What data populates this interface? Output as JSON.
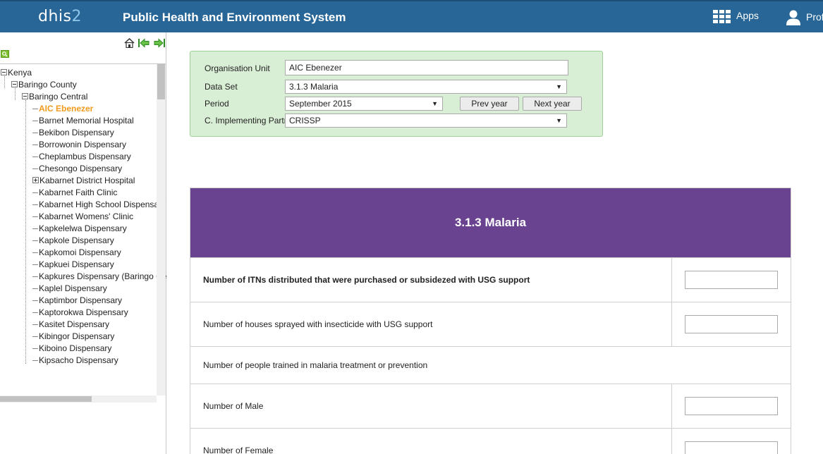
{
  "header": {
    "logo_main": "dhis",
    "logo_num": "2",
    "title": "Public Health and Environment System",
    "apps_label": "Apps",
    "profile_label": "Profile"
  },
  "sidebar": {
    "tree": [
      {
        "label": "Kenya",
        "level": 0,
        "toggle": "minus"
      },
      {
        "label": "Baringo County",
        "level": 1,
        "toggle": "minus"
      },
      {
        "label": "Baringo Central",
        "level": 2,
        "toggle": "minus"
      },
      {
        "label": "AIC Ebenezer",
        "level": 3,
        "toggle": "leaf",
        "selected": true
      },
      {
        "label": "Barnet Memorial Hospital",
        "level": 3,
        "toggle": "leaf"
      },
      {
        "label": "Bekibon Dispensary",
        "level": 3,
        "toggle": "leaf"
      },
      {
        "label": "Borrowonin Dispensary",
        "level": 3,
        "toggle": "leaf"
      },
      {
        "label": "Cheplambus Dispensary",
        "level": 3,
        "toggle": "leaf"
      },
      {
        "label": "Chesongo Dispensary",
        "level": 3,
        "toggle": "leaf"
      },
      {
        "label": "Kabarnet District Hospital",
        "level": 3,
        "toggle": "plus"
      },
      {
        "label": "Kabarnet Faith Clinic",
        "level": 3,
        "toggle": "leaf"
      },
      {
        "label": "Kabarnet High School Dispensary",
        "level": 3,
        "toggle": "leaf"
      },
      {
        "label": "Kabarnet Womens' Clinic",
        "level": 3,
        "toggle": "leaf"
      },
      {
        "label": "Kapkelelwa Dispensary",
        "level": 3,
        "toggle": "leaf"
      },
      {
        "label": "Kapkole Dispensary",
        "level": 3,
        "toggle": "leaf"
      },
      {
        "label": "Kapkomoi Dispensary",
        "level": 3,
        "toggle": "leaf"
      },
      {
        "label": "Kapkuei Dispensary",
        "level": 3,
        "toggle": "leaf"
      },
      {
        "label": "Kapkures Dispensary (Baringo Central)",
        "level": 3,
        "toggle": "leaf"
      },
      {
        "label": "Kaplel Dispensary",
        "level": 3,
        "toggle": "leaf"
      },
      {
        "label": "Kaptimbor Dispensary",
        "level": 3,
        "toggle": "leaf"
      },
      {
        "label": "Kaptorokwa Dispensary",
        "level": 3,
        "toggle": "leaf"
      },
      {
        "label": "Kasitet Dispensary",
        "level": 3,
        "toggle": "leaf"
      },
      {
        "label": "Kibingor Dispensary",
        "level": 3,
        "toggle": "leaf"
      },
      {
        "label": "Kiboino Dispensary",
        "level": 3,
        "toggle": "leaf"
      },
      {
        "label": "Kipsacho Dispensary",
        "level": 3,
        "toggle": "leaf"
      }
    ]
  },
  "form": {
    "org_unit_label": "Organisation Unit",
    "org_unit_value": "AIC Ebenezer",
    "data_set_label": "Data Set",
    "data_set_value": "3.1.3 Malaria",
    "period_label": "Period",
    "period_value": "September 2015",
    "prev_year": "Prev year",
    "next_year": "Next year",
    "partner_label": "C. Implementing Partner",
    "partner_value": "CRISSP"
  },
  "dataset": {
    "title": "3.1.3 Malaria",
    "rows": [
      {
        "label": "Number of ITNs distributed that were purchased or subsidezed with USG support",
        "bold": true,
        "has_input": true
      },
      {
        "label": "Number of houses sprayed with insecticide with USG support",
        "bold": false,
        "has_input": true
      },
      {
        "label": "Number of people trained in malaria treatment or prevention",
        "bold": false,
        "has_input": false
      },
      {
        "label": "Number of Male",
        "bold": false,
        "has_input": true
      },
      {
        "label": "Number of Female",
        "bold": false,
        "has_input": true
      }
    ]
  },
  "colors": {
    "header_bg": "#276696",
    "dataset_header_bg": "#694290",
    "form_box_bg": "#d9efd5",
    "selected_node": "#f29a1d"
  }
}
